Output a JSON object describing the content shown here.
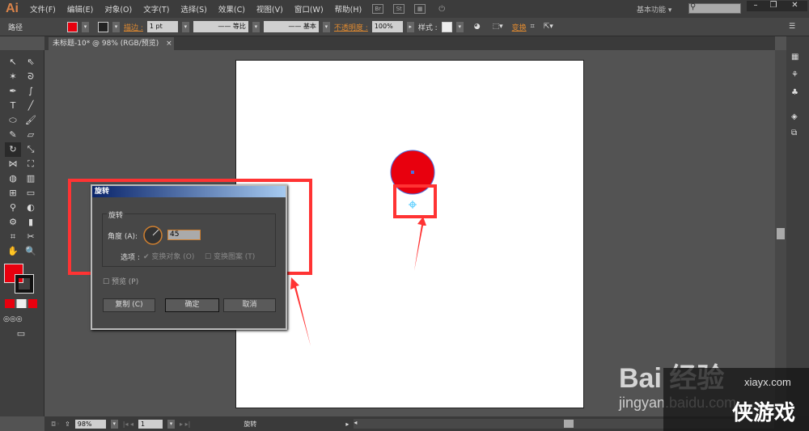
{
  "app": {
    "logo": "Ai",
    "menu": [
      "文件(F)",
      "编辑(E)",
      "对象(O)",
      "文字(T)",
      "选择(S)",
      "效果(C)",
      "视图(V)",
      "窗口(W)",
      "帮助(H)"
    ],
    "br": "Br",
    "st": "St",
    "workspace": "基本功能",
    "search_placeholder": ""
  },
  "control": {
    "selection": "路径",
    "stroke_label": "描边 :",
    "stroke_weight": "1 pt",
    "profile1": "等比",
    "profile2": "基本",
    "opacity_label": "不透明度 :",
    "opacity": "100%",
    "style_label": "样式 :",
    "transform": "变换",
    "fill_color": "#e8000e"
  },
  "document": {
    "tab": "未标题-10* @ 98% (RGB/预览)",
    "close": "×"
  },
  "dialog": {
    "title": "旋转",
    "group": "旋转",
    "angle_label": "角度 (A):",
    "angle": "45",
    "options_label": "选项 :",
    "transform_objects": "变换对象 (O)",
    "transform_patterns": "变换图案 (T)",
    "preview": "预览 (P)",
    "copy": "复制 (C)",
    "ok": "确定",
    "cancel": "取消"
  },
  "status": {
    "zoom": "98%",
    "page": "1",
    "tool": "旋转"
  },
  "watermark": {
    "baidu": "Bai 经验",
    "baidu_url": "jingyan.baidu.com",
    "site": "xiayx.com",
    "site_name": "侠游戏"
  },
  "colors": {
    "annotation": "#ff3333",
    "object": "#e8000e"
  }
}
